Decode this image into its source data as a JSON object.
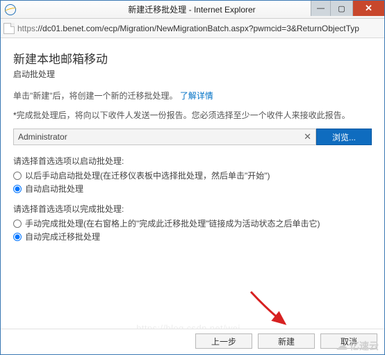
{
  "window": {
    "title": "新建迁移批处理 - Internet Explorer"
  },
  "address": {
    "scheme": "https",
    "rest": "://dc01.benet.com/ecp/Migration/NewMigrationBatch.aspx?pwmcid=3&ReturnObjectTyp"
  },
  "page": {
    "heading": "新建本地邮箱移动",
    "subtitle": "启动批处理",
    "intro_prefix": "单击\"新建\"后，将创建一个新的迁移批处理。",
    "intro_link": "了解详情",
    "report_note": "完成批处理后，将向以下收件人发送一份报告。您必须选择至少一个收件人来接收此报告。",
    "user_value": "Administrator",
    "browse_label": "浏览...",
    "start_group": {
      "label": "请选择首选选项以启动批处理:",
      "opt1": "以后手动启动批处理(在迁移仪表板中选择批处理，然后单击\"开始\")",
      "opt2": "自动启动批处理"
    },
    "complete_group": {
      "label": "请选择首选选项以完成批处理:",
      "opt1": "手动完成批处理(在右窗格上的\"完成此迁移批处理\"链接成为活动状态之后单击它)",
      "opt2": "自动完成迁移批处理"
    }
  },
  "footer": {
    "back": "上一步",
    "create": "新建",
    "cancel": "取消"
  },
  "watermark": {
    "ghost_url": "https://blog.csdn.net/wei...",
    "brand": "亿速云"
  }
}
